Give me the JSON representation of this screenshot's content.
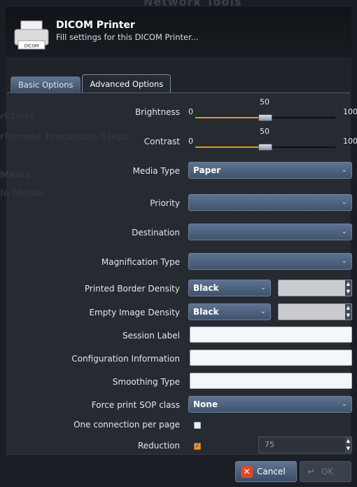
{
  "background": {
    "window_title": "Network Tools",
    "ghost_items": [
      "rkLists",
      "rformed Procedure Steps",
      "Media",
      "le Media"
    ]
  },
  "header": {
    "icon": "printer-icon",
    "icon_label": "DICOM",
    "title": "DICOM Printer",
    "subtitle": "Fill settings for this DICOM Printer..."
  },
  "tabs": [
    {
      "label": "Basic Options",
      "active": false
    },
    {
      "label": "Advanced Options",
      "active": true
    }
  ],
  "form": {
    "brightness": {
      "label": "Brightness",
      "min": "0",
      "max": "100",
      "value": "50",
      "fraction": 0.5
    },
    "contrast": {
      "label": "Contrast",
      "min": "0",
      "max": "100",
      "value": "50",
      "fraction": 0.5
    },
    "media_type": {
      "label": "Media Type",
      "value": "Paper"
    },
    "priority": {
      "label": "Priority",
      "value": ""
    },
    "destination": {
      "label": "Destination",
      "value": ""
    },
    "magnification_type": {
      "label": "Magnification Type",
      "value": ""
    },
    "printed_border_density": {
      "label": "Printed Border Density",
      "value": "Black",
      "spin_value": ""
    },
    "empty_image_density": {
      "label": "Empty Image Density",
      "value": "Black",
      "spin_value": ""
    },
    "session_label": {
      "label": "Session Label",
      "value": ""
    },
    "configuration_information": {
      "label": "Configuration Information",
      "value": ""
    },
    "smoothing_type": {
      "label": "Smoothing Type",
      "value": ""
    },
    "force_print_sop_class": {
      "label": "Force print SOP class",
      "value": "None"
    },
    "one_connection_per_page": {
      "label": "One connection per page",
      "checked": false
    },
    "reduction": {
      "label": "Reduction",
      "checked": true,
      "value": "75"
    }
  },
  "footer": {
    "cancel_label": "Cancel",
    "ok_label": "OK"
  },
  "colors": {
    "accent": "#e8952f",
    "combo": "#4f6480",
    "cancel_icon": "#d84b2a"
  }
}
